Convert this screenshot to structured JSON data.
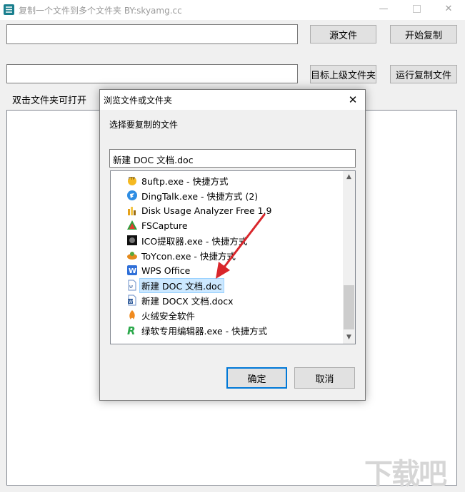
{
  "window": {
    "title": "复制一个文件到多个文件夹   BY:skyamg.cc",
    "minimize": "—",
    "close": "✕"
  },
  "main": {
    "source_input_value": "",
    "target_input_value": "",
    "source_button": "源文件",
    "start_copy_button": "开始复制",
    "target_parent_button": "目标上级文件夹",
    "run_copy_button": "运行复制文件",
    "hint_label": "双击文件夹可打开"
  },
  "dialog": {
    "title": "浏览文件或文件夹",
    "close": "✕",
    "prompt": "选择要复制的文件",
    "path_value": "新建 DOC 文档.doc",
    "items": [
      {
        "label": "8uftp.exe - 快捷方式",
        "icon": "ftp-icon"
      },
      {
        "label": "DingTalk.exe - 快捷方式 (2)",
        "icon": "dingtalk-icon"
      },
      {
        "label": "Disk Usage Analyzer Free 1.9",
        "icon": "disk-analyzer-icon"
      },
      {
        "label": "FSCapture",
        "icon": "fscapture-icon"
      },
      {
        "label": "ICO提取器.exe - 快捷方式",
        "icon": "ico-extractor-icon"
      },
      {
        "label": "ToYcon.exe - 快捷方式",
        "icon": "toycon-icon"
      },
      {
        "label": "WPS Office",
        "icon": "wps-icon"
      },
      {
        "label": "新建 DOC 文档.doc",
        "icon": "doc-file-icon",
        "selected": true
      },
      {
        "label": "新建 DOCX 文档.docx",
        "icon": "docx-file-icon"
      },
      {
        "label": "火绒安全软件",
        "icon": "huorong-icon"
      },
      {
        "label": "绿软专用编辑器.exe - 快捷方式",
        "icon": "editor-icon"
      }
    ],
    "ok_button": "确定",
    "cancel_button": "取消"
  },
  "watermark": "下载吧",
  "colors": {
    "selection_bg": "#cce8ff",
    "focus_border": "#0078d7",
    "annotation_arrow": "#d9262b"
  }
}
